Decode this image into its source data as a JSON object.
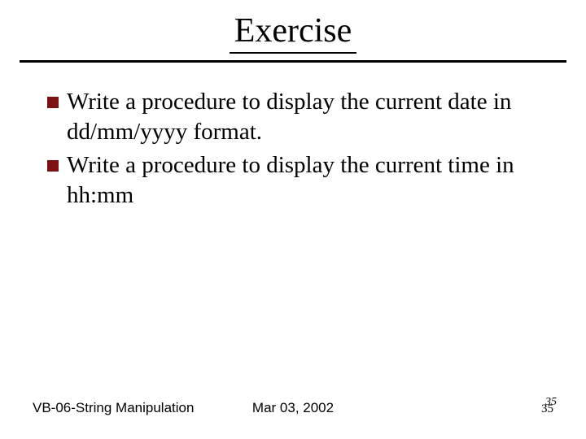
{
  "title": "Exercise",
  "bullets": [
    "Write  a procedure to display the current date in dd/mm/yyyy format.",
    "Write a procedure to display the current time in hh:mm"
  ],
  "footer": {
    "left": "VB-06-String Manipulation",
    "center": "Mar 03, 2002",
    "page": "35",
    "page_overlay": "35"
  },
  "colors": {
    "bullet": "#7b1113"
  }
}
